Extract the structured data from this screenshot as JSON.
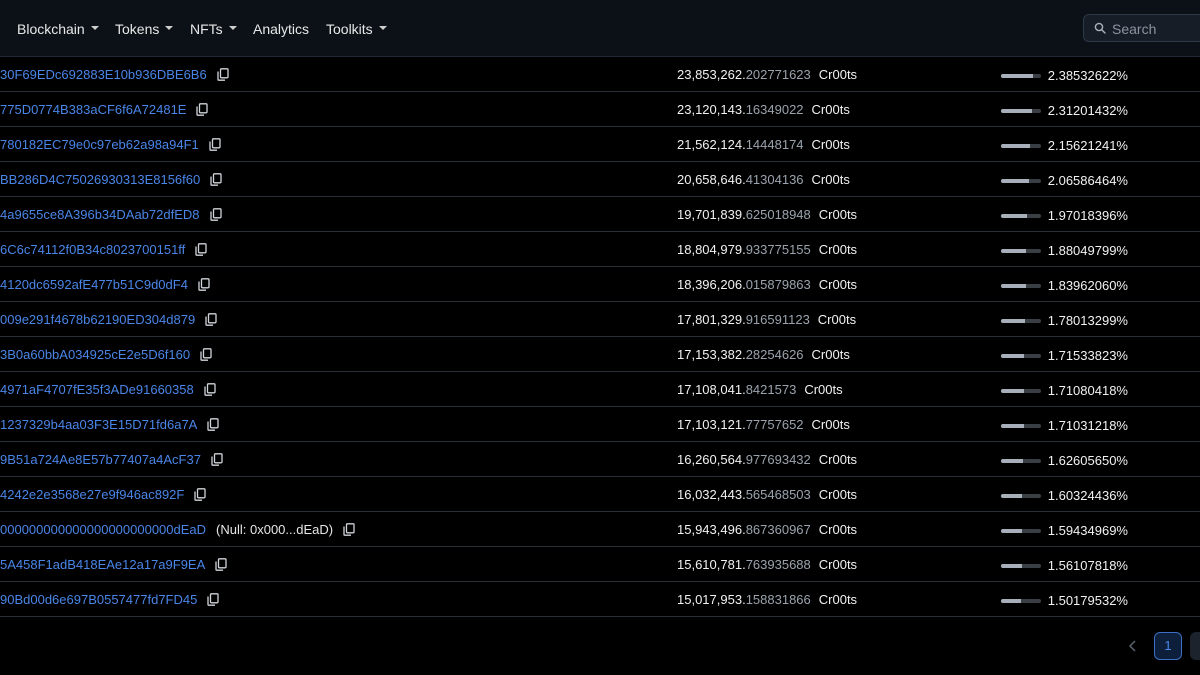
{
  "nav": {
    "items": [
      {
        "label": "Blockchain",
        "dropdown": true
      },
      {
        "label": "Tokens",
        "dropdown": true
      },
      {
        "label": "NFTs",
        "dropdown": true
      },
      {
        "label": "Analytics",
        "dropdown": false
      },
      {
        "label": "Toolkits",
        "dropdown": true
      }
    ],
    "search_placeholder": "Search"
  },
  "holders": [
    {
      "address": "30F69EDc692883E10b936DBE6B6",
      "note": "",
      "qty_int": "23,853,262.",
      "qty_dec": "202771623",
      "unit": "Cr00ts",
      "pct": "2.38532622%",
      "pct_value": 2.38532622
    },
    {
      "address": "775D0774B383aCF6f6A72481E",
      "note": "",
      "qty_int": "23,120,143.",
      "qty_dec": "16349022",
      "unit": "Cr00ts",
      "pct": "2.31201432%",
      "pct_value": 2.31201432
    },
    {
      "address": "780182EC79e0c97eb62a98a94F1",
      "note": "",
      "qty_int": "21,562,124.",
      "qty_dec": "14448174",
      "unit": "Cr00ts",
      "pct": "2.15621241%",
      "pct_value": 2.15621241
    },
    {
      "address": "BB286D4C75026930313E8156f60",
      "note": "",
      "qty_int": "20,658,646.",
      "qty_dec": "41304136",
      "unit": "Cr00ts",
      "pct": "2.06586464%",
      "pct_value": 2.06586464
    },
    {
      "address": "4a9655ce8A396b34DAab72dfED8",
      "note": "",
      "qty_int": "19,701,839.",
      "qty_dec": "625018948",
      "unit": "Cr00ts",
      "pct": "1.97018396%",
      "pct_value": 1.97018396
    },
    {
      "address": "6C6c74112f0B34c8023700151ff",
      "note": "",
      "qty_int": "18,804,979.",
      "qty_dec": "933775155",
      "unit": "Cr00ts",
      "pct": "1.88049799%",
      "pct_value": 1.88049799
    },
    {
      "address": "4120dc6592afE477b51C9d0dF4",
      "note": "",
      "qty_int": "18,396,206.",
      "qty_dec": "015879863",
      "unit": "Cr00ts",
      "pct": "1.83962060%",
      "pct_value": 1.8396206
    },
    {
      "address": "009e291f4678b62190ED304d879",
      "note": "",
      "qty_int": "17,801,329.",
      "qty_dec": "916591123",
      "unit": "Cr00ts",
      "pct": "1.78013299%",
      "pct_value": 1.78013299
    },
    {
      "address": "3B0a60bbA034925cE2e5D6f160",
      "note": "",
      "qty_int": "17,153,382.",
      "qty_dec": "28254626",
      "unit": "Cr00ts",
      "pct": "1.71533823%",
      "pct_value": 1.71533823
    },
    {
      "address": "4971aF4707fE35f3ADe91660358",
      "note": "",
      "qty_int": "17,108,041.",
      "qty_dec": "8421573",
      "unit": "Cr00ts",
      "pct": "1.71080418%",
      "pct_value": 1.71080418
    },
    {
      "address": "1237329b4aa03F3E15D71fd6a7A",
      "note": "",
      "qty_int": "17,103,121.",
      "qty_dec": "77757652",
      "unit": "Cr00ts",
      "pct": "1.71031218%",
      "pct_value": 1.71031218
    },
    {
      "address": "9B51a724Ae8E57b77407a4AcF37",
      "note": "",
      "qty_int": "16,260,564.",
      "qty_dec": "977693432",
      "unit": "Cr00ts",
      "pct": "1.62605650%",
      "pct_value": 1.6260565
    },
    {
      "address": "4242e2e3568e27e9f946ac892F",
      "note": "",
      "qty_int": "16,032,443.",
      "qty_dec": "565468503",
      "unit": "Cr00ts",
      "pct": "1.60324436%",
      "pct_value": 1.60324436
    },
    {
      "address": "000000000000000000000000dEaD",
      "note": "(Null: 0x000...dEaD)",
      "qty_int": "15,943,496.",
      "qty_dec": "867360967",
      "unit": "Cr00ts",
      "pct": "1.59434969%",
      "pct_value": 1.59434969
    },
    {
      "address": "5A458F1adB418EAe12a17a9F9EA",
      "note": "",
      "qty_int": "15,610,781.",
      "qty_dec": "763935688",
      "unit": "Cr00ts",
      "pct": "1.56107818%",
      "pct_value": 1.56107818
    },
    {
      "address": "90Bd00d6e697B0557477fd7FD45",
      "note": "",
      "qty_int": "15,017,953.",
      "qty_dec": "158831866",
      "unit": "Cr00ts",
      "pct": "1.50179532%",
      "pct_value": 1.50179532
    }
  ],
  "pagination": {
    "current_page": "1",
    "prev_icon": "chevron-left-icon"
  }
}
